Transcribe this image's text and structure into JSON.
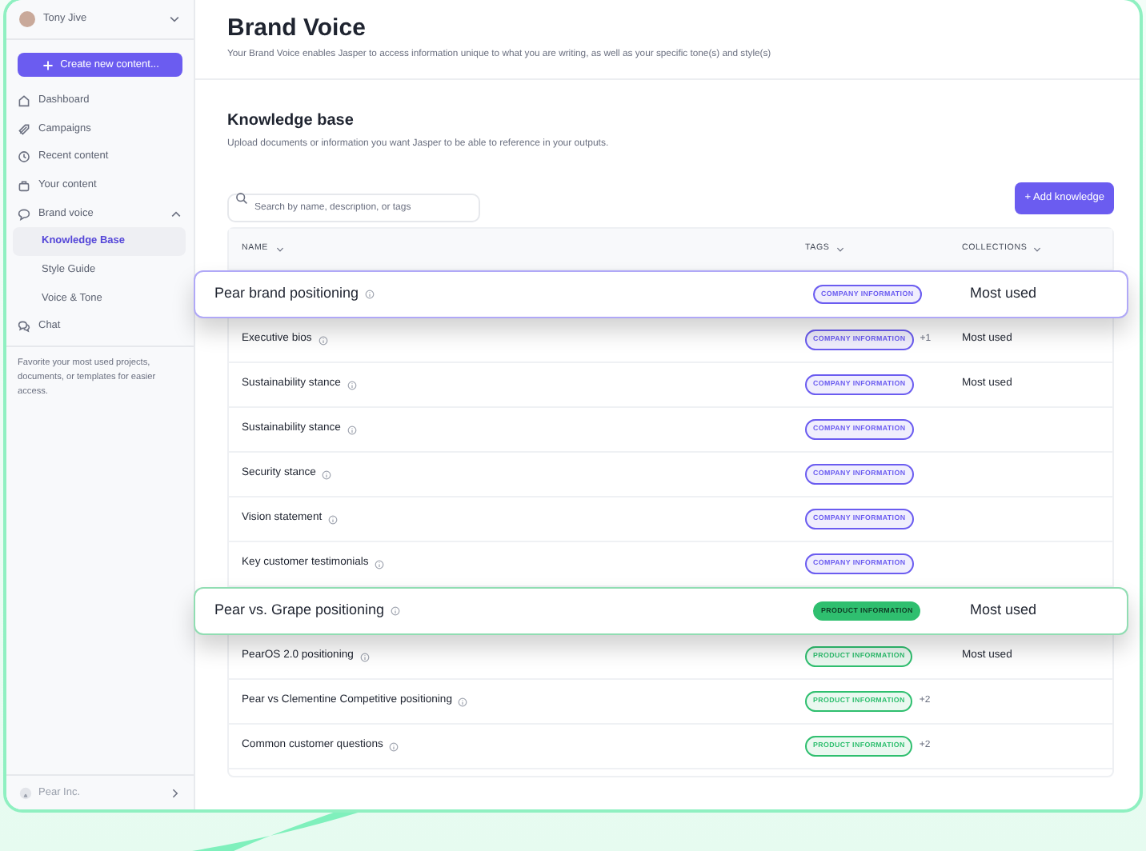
{
  "sidebar": {
    "user": "Tony Jive",
    "create_button": "Create new content...",
    "items": [
      {
        "label": "Dashboard",
        "selected": false
      },
      {
        "label": "Campaigns",
        "selected": false
      },
      {
        "label": "Recent content",
        "selected": false
      },
      {
        "label": "Your content",
        "selected": false
      },
      {
        "label": "Brand voice",
        "selected": false,
        "expanded": true,
        "children": [
          {
            "label": "Knowledge Base",
            "selected": true
          },
          {
            "label": "Style Guide",
            "selected": false
          },
          {
            "label": "Voice & Tone",
            "selected": false
          }
        ]
      },
      {
        "label": "Chat",
        "selected": false
      }
    ],
    "favorites_hint": "Favorite your most used projects, documents, or templates for easier access.",
    "workspace": "Pear Inc."
  },
  "header": {
    "title": "Brand Voice",
    "subtitle": "Your Brand Voice enables Jasper to access information unique to what you are writing, as well as your specific tone(s) and style(s)"
  },
  "knowledge": {
    "title": "Knowledge base",
    "description": "Upload documents or information you want Jasper to be able to reference in your outputs.",
    "search": {
      "placeholder": "Search by name, description, or tags"
    },
    "add_button": "+ Add knowledge",
    "columns": [
      "NAME",
      "TAGS",
      "COLLECTIONS"
    ],
    "rows": [
      {
        "kind": "floating",
        "name": "Pear brand positioning",
        "tag": {
          "label": "COMPANY INFORMATION",
          "color": "#6b5cf0",
          "filled": false
        },
        "collection": "Most used"
      },
      {
        "kind": "plain",
        "name": "Executive bios",
        "tag": {
          "label": "COMPANY INFORMATION",
          "color": "#6b5cf0",
          "filled": false
        },
        "extra": "+1",
        "collection": "Most used"
      },
      {
        "kind": "plain",
        "name": "Sustainability stance",
        "tag": {
          "label": "COMPANY INFORMATION",
          "color": "#6b5cf0",
          "filled": false
        },
        "collection": "Most used"
      },
      {
        "kind": "plain",
        "name": "Sustainability stance",
        "tag": {
          "label": "COMPANY INFORMATION",
          "color": "#6b5cf0",
          "filled": false
        }
      },
      {
        "kind": "plain",
        "name": "Security stance",
        "tag": {
          "label": "COMPANY INFORMATION",
          "color": "#6b5cf0",
          "filled": false
        }
      },
      {
        "kind": "plain",
        "name": "Vision statement",
        "tag": {
          "label": "COMPANY INFORMATION",
          "color": "#6b5cf0",
          "filled": false
        }
      },
      {
        "kind": "plain",
        "name": "Key customer testimonials",
        "tag": {
          "label": "COMPANY INFORMATION",
          "color": "#6b5cf0",
          "filled": false
        }
      },
      {
        "kind": "floating",
        "name": "Pear vs. Grape positioning",
        "tag": {
          "label": "PRODUCT INFORMATION",
          "color": "#2fbf6f",
          "filled": true
        },
        "collection": "Most used"
      },
      {
        "kind": "plain",
        "name": "PearOS 2.0 positioning",
        "tag": {
          "label": "PRODUCT INFORMATION",
          "color": "#2fbf6f",
          "filled": false
        },
        "collection": "Most used"
      },
      {
        "kind": "plain",
        "name": "Pear vs Clementine Competitive positioning",
        "tag": {
          "label": "PRODUCT INFORMATION",
          "color": "#2fbf6f",
          "filled": false
        },
        "extra": "+2"
      },
      {
        "kind": "plain",
        "name": "Common customer questions",
        "tag": {
          "label": "PRODUCT INFORMATION",
          "color": "#2fbf6f",
          "filled": false
        },
        "extra": "+2"
      }
    ]
  }
}
